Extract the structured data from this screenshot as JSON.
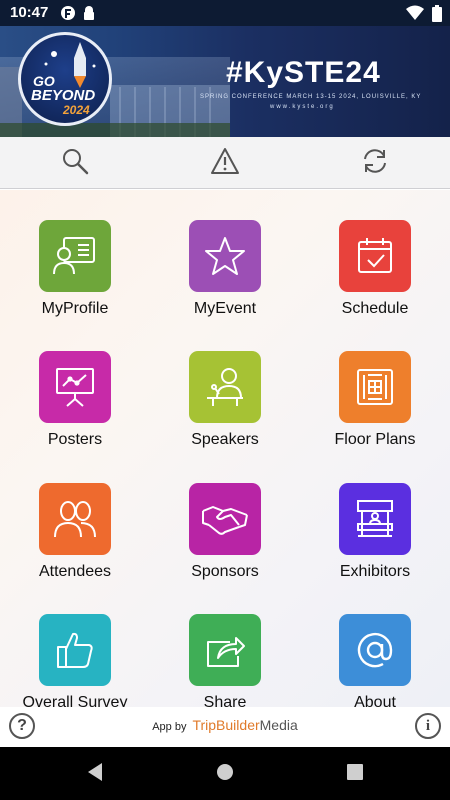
{
  "status_bar": {
    "time": "10:47",
    "left_icons": [
      "app-notification-icon",
      "security-notification-icon"
    ],
    "right_icons": [
      "wifi-icon",
      "battery-icon"
    ]
  },
  "banner": {
    "hashtag": "#KySTE24",
    "subtitle": "SPRING CONFERENCE MARCH 13-15 2024, LOUISVILLE, KY",
    "url": "www.kyste.org",
    "logo": {
      "line1": "GO",
      "line2": "BEYOND",
      "year": "2024"
    }
  },
  "toolbar": {
    "buttons": [
      {
        "name": "search",
        "icon": "search-icon"
      },
      {
        "name": "alerts",
        "icon": "warning-icon"
      },
      {
        "name": "sync",
        "icon": "refresh-icon"
      }
    ]
  },
  "tiles": [
    {
      "label": "MyProfile",
      "color": "#6ea63a",
      "icon": "profile-card-icon"
    },
    {
      "label": "MyEvent",
      "color": "#9c4fb5",
      "icon": "star-icon"
    },
    {
      "label": "Schedule",
      "color": "#e8423c",
      "icon": "calendar-check-icon"
    },
    {
      "label": "Posters",
      "color": "#c72aa8",
      "icon": "presentation-board-icon"
    },
    {
      "label": "Speakers",
      "color": "#a6c234",
      "icon": "speaker-podium-icon"
    },
    {
      "label": "Floor Plans",
      "color": "#ee7f2c",
      "icon": "floor-plan-icon"
    },
    {
      "label": "Attendees",
      "color": "#ee6a2e",
      "icon": "people-icon"
    },
    {
      "label": "Sponsors",
      "color": "#b824a5",
      "icon": "handshake-icon"
    },
    {
      "label": "Exhibitors",
      "color": "#5b2fe0",
      "icon": "booth-icon"
    },
    {
      "label": "Overall Survey",
      "color": "#27b3c2",
      "icon": "thumbs-up-icon"
    },
    {
      "label": "Share",
      "color": "#3fae56",
      "icon": "share-icon"
    },
    {
      "label": "About",
      "color": "#3d8ed8",
      "icon": "at-sign-icon"
    }
  ],
  "footer": {
    "credit_prefix": "App by",
    "brand_part1": "TripBuilder",
    "brand_part2": "Media",
    "help": "?",
    "info": "i"
  },
  "navigation_bar": {
    "buttons": [
      "back-icon",
      "home-icon",
      "recents-icon"
    ]
  }
}
